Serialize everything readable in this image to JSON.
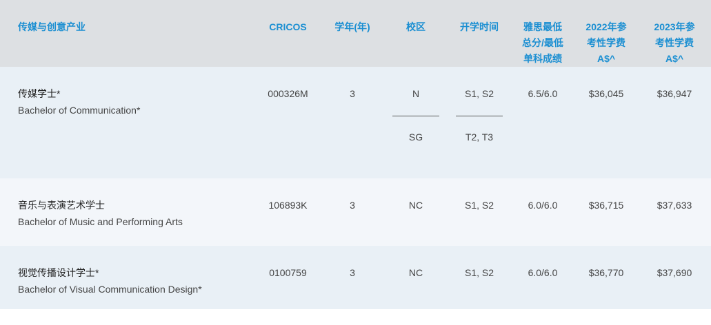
{
  "headers": {
    "program": "传媒与创意产业",
    "cricos": "CRICOS",
    "years": "学年(年)",
    "campus": "校区",
    "intake": "开学时间",
    "ielts_l1": "雅思最低",
    "ielts_l2": "总分/最低",
    "ielts_l3": "单科成绩",
    "fee2022_l1": "2022年参",
    "fee2022_l2": "考性学费",
    "fee2022_l3": "A$^",
    "fee2023_l1": "2023年参",
    "fee2023_l2": "考性学费",
    "fee2023_l3": "A$^"
  },
  "rows": [
    {
      "name_zh": "传媒学士*",
      "name_en": "Bachelor of Communication*",
      "cricos": "000326M",
      "years": "3",
      "campus_top": "N",
      "campus_bottom": "SG",
      "intake_top": "S1, S2",
      "intake_bottom": "T2, T3",
      "ielts": "6.5/6.0",
      "fee2022": "$36,045",
      "fee2023": "$36,947"
    },
    {
      "name_zh": "音乐与表演艺术学士",
      "name_en": "Bachelor of Music and Performing Arts",
      "cricos": "106893K",
      "years": "3",
      "campus": "NC",
      "intake": "S1, S2",
      "ielts": "6.0/6.0",
      "fee2022": "$36,715",
      "fee2023": "$37,633"
    },
    {
      "name_zh": "视觉传播设计学士*",
      "name_en": "Bachelor of Visual Communication Design*",
      "cricos": "0100759",
      "years": "3",
      "campus": "NC",
      "intake": "S1, S2",
      "ielts": "6.0/6.0",
      "fee2022": "$36,770",
      "fee2023": "$37,690"
    }
  ]
}
